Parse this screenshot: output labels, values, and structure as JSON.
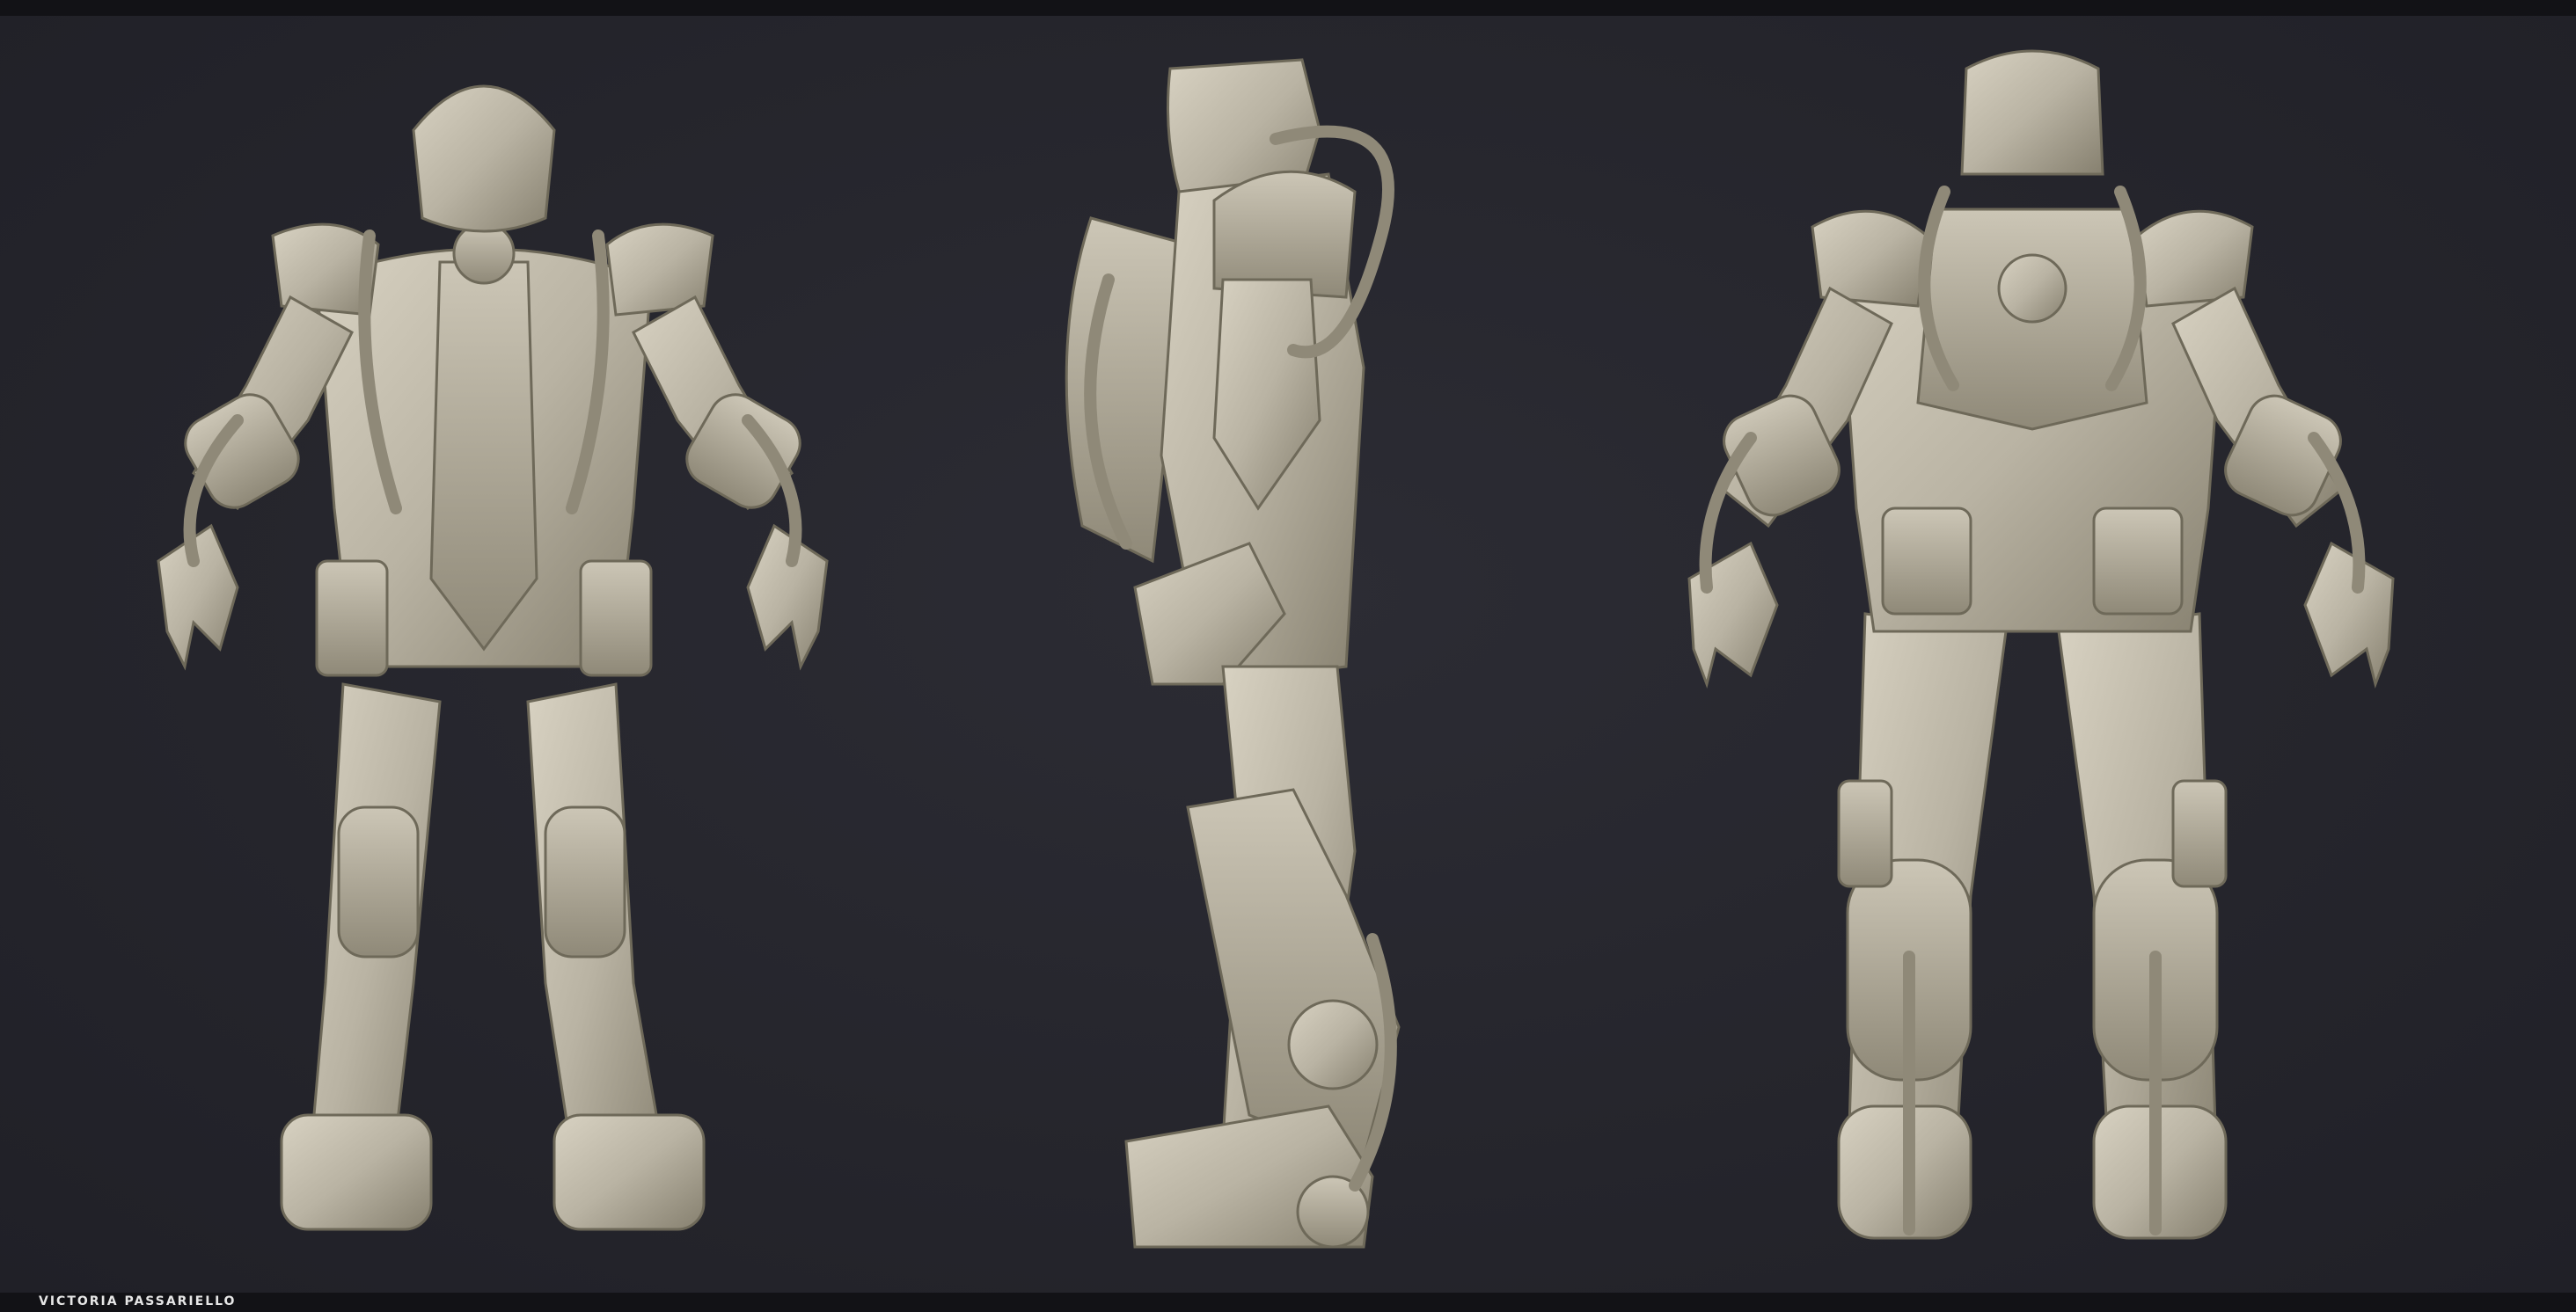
{
  "canvas": {
    "background_color": "#24242b",
    "frame_color": "#121216",
    "clay_color": "#bcb6a6"
  },
  "figure_views": [
    {
      "view": "front",
      "icon": "astronaut-front-view"
    },
    {
      "view": "side",
      "icon": "astronaut-side-view"
    },
    {
      "view": "back",
      "icon": "astronaut-back-view"
    }
  ],
  "credit": {
    "text": "VICTORIA PASSARIELLO"
  }
}
